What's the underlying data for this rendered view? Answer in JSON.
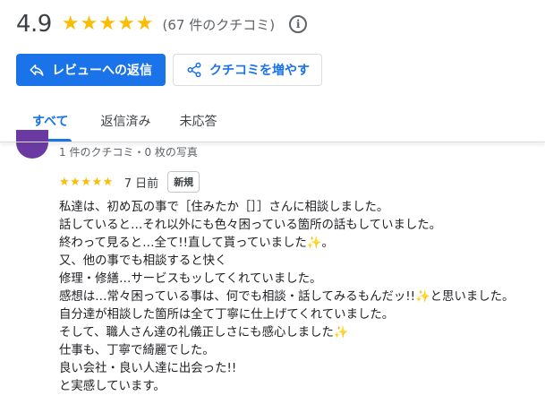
{
  "summary": {
    "rating": "4.9",
    "stars": 5,
    "count_text": "(67 件のクチコミ)",
    "info_icon": "i"
  },
  "actions": {
    "reply_label": "レビューへの返信",
    "share_label": "クチコミを増やす"
  },
  "tabs": {
    "all": "すべて",
    "replied": "返信済み",
    "unanswered": "未応答"
  },
  "review": {
    "meta": "1 件のクチコミ・0 枚の写真",
    "stars": 5,
    "date": "7 日前",
    "badge": "新規",
    "lines": [
      "私達は、初め瓦の事で［住みたか［］］さんに相談しました。",
      "話していると…それ以外にも色々困っている箇所の話もしていました。",
      "終わって見ると…全て!!直して貰っていました✨。",
      "又、他の事でも相談すると快く",
      "修理・修繕…サービスもッしてくれていました。",
      "感想は…常々困っている事は、何でも相談・話してみるもんだッ!!✨と思いました。",
      "自分達が相談した箇所は全て丁寧に仕上げてくれていました。",
      "そして、職人さん達の礼儀正しさにも感心しました✨",
      "仕事も、丁寧で綺麗でした。",
      "良い会社・良い人達に出会った!!",
      "と実感しています。"
    ]
  },
  "colors": {
    "accent": "#1a73e8",
    "star": "#fbbc04",
    "avatar": "#6a3aa2"
  }
}
